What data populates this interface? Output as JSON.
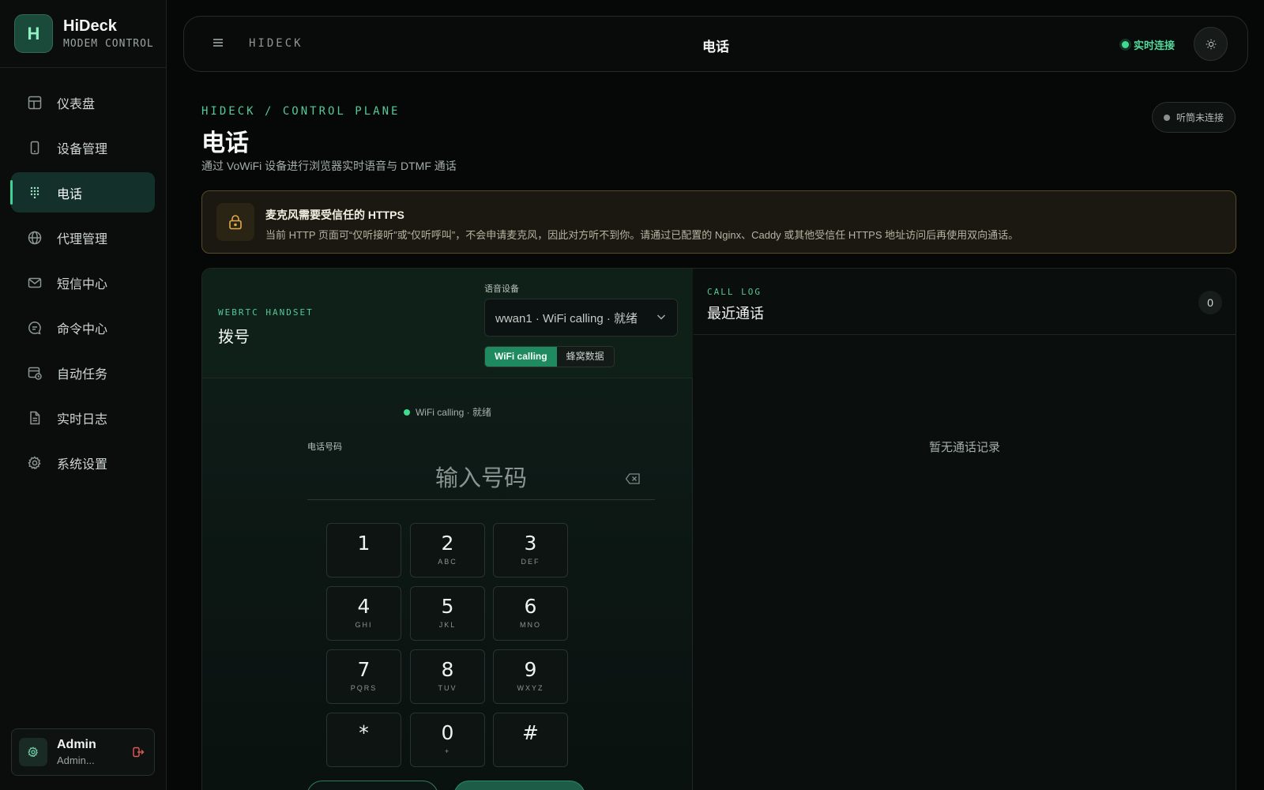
{
  "brand": {
    "logo_letter": "H",
    "name": "HiDeck",
    "subtitle": "MODEM CONTROL"
  },
  "sidebar": {
    "items": [
      {
        "label": "仪表盘",
        "icon": "dashboard-icon"
      },
      {
        "label": "设备管理",
        "icon": "device-icon"
      },
      {
        "label": "电话",
        "icon": "dialpad-icon",
        "active": true
      },
      {
        "label": "代理管理",
        "icon": "globe-icon"
      },
      {
        "label": "短信中心",
        "icon": "mail-icon"
      },
      {
        "label": "命令中心",
        "icon": "chat-icon"
      },
      {
        "label": "自动任务",
        "icon": "calendar-clock-icon"
      },
      {
        "label": "实时日志",
        "icon": "file-icon"
      },
      {
        "label": "系统设置",
        "icon": "gear-icon"
      }
    ],
    "user": {
      "name": "Admin",
      "role": "Admin..."
    }
  },
  "topbar": {
    "brand": "HIDECK",
    "title": "电话",
    "status": "实时连接"
  },
  "page": {
    "breadcrumb": "HIDECK / CONTROL PLANE",
    "title": "电话",
    "subtitle": "通过 VoWiFi 设备进行浏览器实时语音与 DTMF 通话",
    "handset_status": "听筒未连接"
  },
  "warning": {
    "title": "麦克风需要受信任的 HTTPS",
    "text": "当前 HTTP 页面可“仅听接听”或“仅听呼叫”，不会申请麦克风，因此对方听不到你。请通过已配置的 Nginx、Caddy 或其他受信任 HTTPS 地址访问后再使用双向通话。"
  },
  "dialer": {
    "kicker": "WEBRTC HANDSET",
    "title": "拨号",
    "voice_device_label": "语音设备",
    "voice_device_value": "wwan1 · WiFi calling · 就绪",
    "mode_options": [
      "WiFi calling",
      "蜂窝数据"
    ],
    "mode_selected": "WiFi calling",
    "status": "WiFi calling · 就绪",
    "phone_label": "电话号码",
    "phone_placeholder": "输入号码",
    "keys": [
      {
        "digit": "1",
        "letters": ""
      },
      {
        "digit": "2",
        "letters": "ABC"
      },
      {
        "digit": "3",
        "letters": "DEF"
      },
      {
        "digit": "4",
        "letters": "GHI"
      },
      {
        "digit": "5",
        "letters": "JKL"
      },
      {
        "digit": "6",
        "letters": "MNO"
      },
      {
        "digit": "7",
        "letters": "PQRS"
      },
      {
        "digit": "8",
        "letters": "TUV"
      },
      {
        "digit": "9",
        "letters": "WXYZ"
      },
      {
        "digit": "*",
        "letters": ""
      },
      {
        "digit": "0",
        "letters": "+"
      },
      {
        "digit": "#",
        "letters": ""
      }
    ]
  },
  "call_log": {
    "kicker": "CALL LOG",
    "title": "最近通话",
    "count": "0",
    "empty_text": "暂无通话记录"
  },
  "colors": {
    "accent": "#3ddc8f",
    "warning_border": "#5a4a26",
    "danger": "#e05a5a"
  }
}
